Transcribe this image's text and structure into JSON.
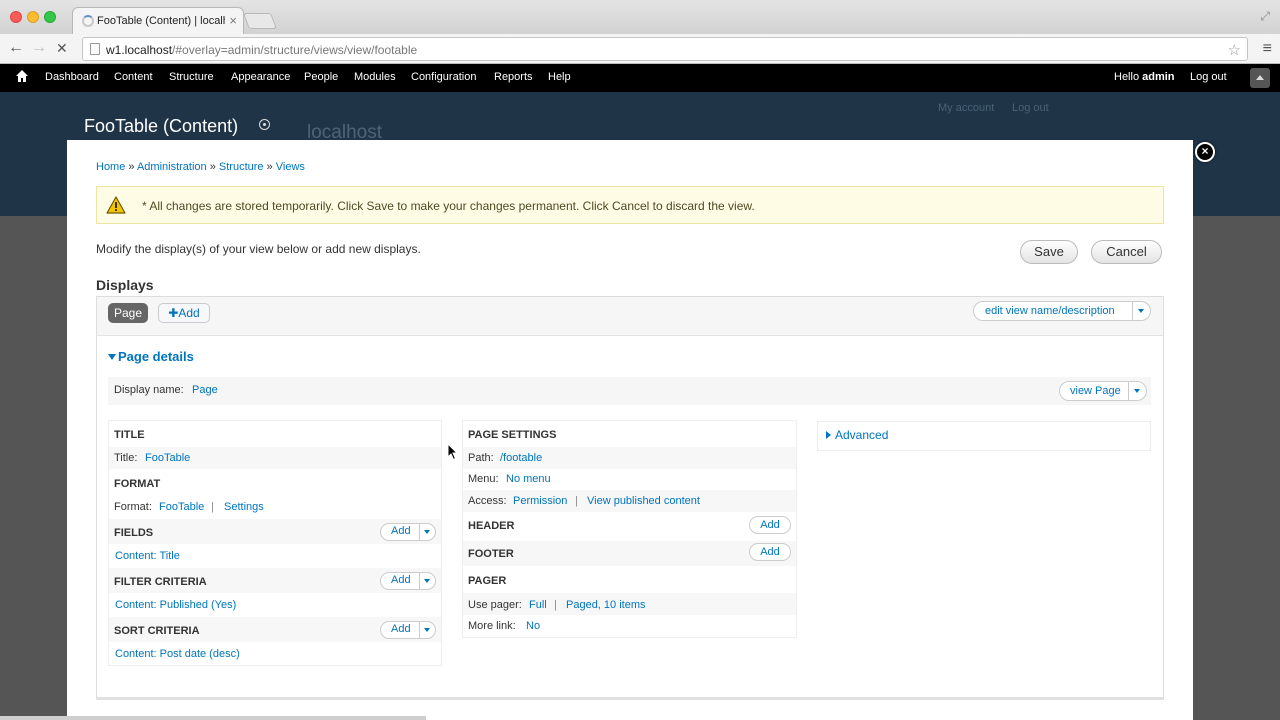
{
  "browser": {
    "tab_title": "FooTable (Content) | localh",
    "tab_close": "×",
    "url_host": "w1.localhost",
    "url_path": "/#overlay=admin/structure/views/view/footable",
    "back_glyph": "←",
    "forward_glyph": "→",
    "stop_glyph": "✕",
    "star_glyph": "☆",
    "menu_glyph": "≡",
    "fullscreen_glyph": "⤢"
  },
  "toolbar": {
    "items": [
      "Dashboard",
      "Content",
      "Structure",
      "Appearance",
      "People",
      "Modules",
      "Configuration",
      "Reports",
      "Help"
    ],
    "hello_prefix": "Hello ",
    "user": "admin",
    "logout": "Log out"
  },
  "background": {
    "page_title": "FooTable (Content)",
    "site_name": "localhost",
    "my_account": "My account",
    "log_out": "Log out"
  },
  "overlay": {
    "close_glyph": "×",
    "breadcrumb": [
      "Home",
      "Administration",
      "Structure",
      "Views"
    ],
    "breadcrumb_sep": " » ",
    "warning": "* All changes are stored temporarily. Click Save to make your changes permanent. Click Cancel to discard the view.",
    "intro": "Modify the display(s) of your view below or add new displays.",
    "save": "Save",
    "cancel": "Cancel",
    "displays_title": "Displays",
    "page_tab": "Page",
    "add_tab": "✚Add",
    "edit_view_name": "edit view name/description",
    "page_details": "Page details",
    "display_name_label": "Display name:",
    "display_name_value": "Page",
    "view_page": "view Page",
    "advanced": "Advanced"
  },
  "left_column": {
    "title_head": "TITLE",
    "title_label": "Title:",
    "title_value": "FooTable",
    "format_head": "FORMAT",
    "format_label": "Format:",
    "format_value": "FooTable",
    "format_sep": "|",
    "format_settings": "Settings",
    "fields_head": "FIELDS",
    "fields_value": "Content: Title",
    "filter_head": "FILTER CRITERIA",
    "filter_value": "Content: Published (Yes)",
    "sort_head": "SORT CRITERIA",
    "sort_value": "Content: Post date (desc)",
    "add_label": "Add"
  },
  "middle_column": {
    "page_settings_head": "PAGE SETTINGS",
    "path_label": "Path:",
    "path_value": "/footable",
    "menu_label": "Menu:",
    "menu_value": "No menu",
    "access_label": "Access:",
    "access_value": "Permission",
    "access_sep": "|",
    "access_detail": "View published content",
    "header_head": "HEADER",
    "footer_head": "FOOTER",
    "pager_head": "PAGER",
    "use_pager_label": "Use pager:",
    "use_pager_value": "Full",
    "pager_sep": "|",
    "pager_detail": "Paged, 10 items",
    "more_link_label": "More link:",
    "more_link_value": "No",
    "add_label": "Add"
  },
  "colors": {
    "link": "#0074bd",
    "toolbar_bg": "#000000",
    "warning_bg": "#fffce5",
    "header_bg": "#1f3446"
  }
}
